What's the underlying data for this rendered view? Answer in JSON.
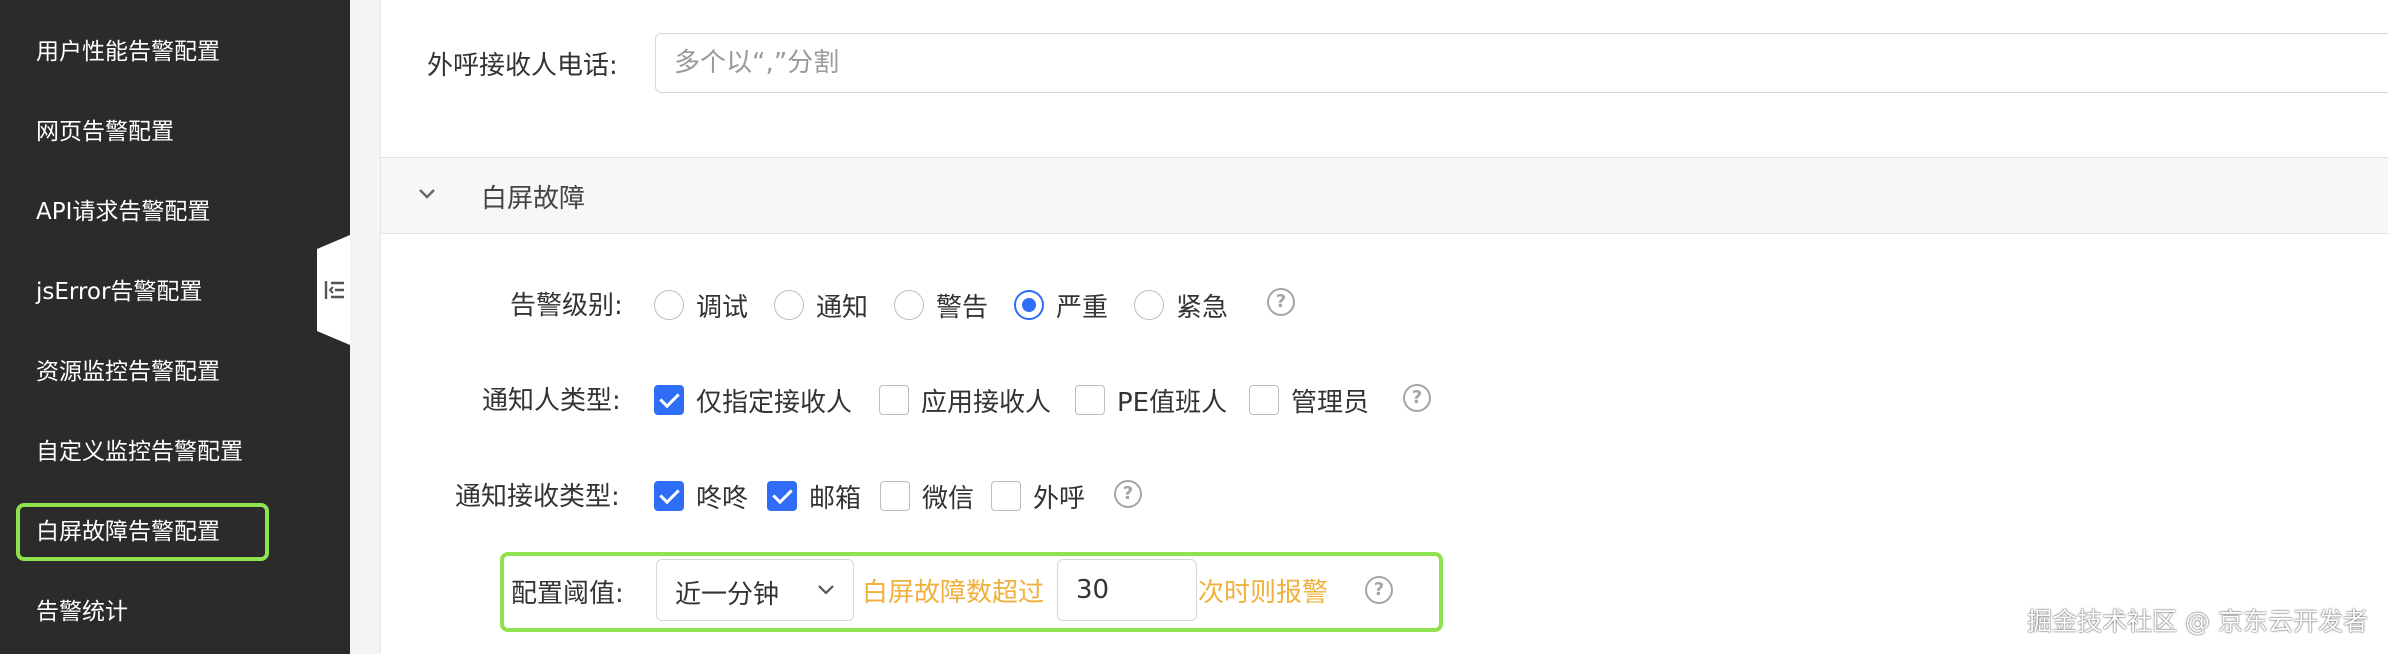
{
  "sidebar": {
    "items": [
      {
        "label": "用户性能告警配置"
      },
      {
        "label": "网页告警配置"
      },
      {
        "label": "API请求告警配置"
      },
      {
        "label": "jsError告警配置"
      },
      {
        "label": "资源监控告警配置"
      },
      {
        "label": "自定义监控告警配置"
      },
      {
        "label": "白屏故障告警配置"
      },
      {
        "label": "告警统计"
      }
    ],
    "active_index": 6,
    "highlight_color": "#8fe14d"
  },
  "form": {
    "phone": {
      "label": "外呼接收人电话:",
      "placeholder": "多个以“,”分割",
      "value": ""
    },
    "section": {
      "title": "白屏故障",
      "expanded": true
    },
    "level": {
      "label": "告警级别:",
      "options": [
        "调试",
        "通知",
        "警告",
        "严重",
        "紧急"
      ],
      "selected": "严重"
    },
    "notifier_type": {
      "label": "通知人类型:",
      "options": [
        {
          "label": "仅指定接收人",
          "checked": true
        },
        {
          "label": "应用接收人",
          "checked": false
        },
        {
          "label": "PE值班人",
          "checked": false
        },
        {
          "label": "管理员",
          "checked": false
        }
      ]
    },
    "receive_type": {
      "label": "通知接收类型:",
      "options": [
        {
          "label": "咚咚",
          "checked": true
        },
        {
          "label": "邮箱",
          "checked": true
        },
        {
          "label": "微信",
          "checked": false
        },
        {
          "label": "外呼",
          "checked": false
        }
      ]
    },
    "threshold": {
      "label": "配置阈值:",
      "period": "近一分钟",
      "prefix": "白屏故障数超过",
      "value": "30",
      "suffix": "次时则报警"
    },
    "help_icon": "?"
  },
  "watermark": "掘金技术社区 @ 京东云开发者",
  "colors": {
    "primary": "#2f6df6",
    "accent_text": "#f0b13c",
    "highlight": "#8fe14d",
    "sidebar_bg": "#2b2b2b"
  }
}
